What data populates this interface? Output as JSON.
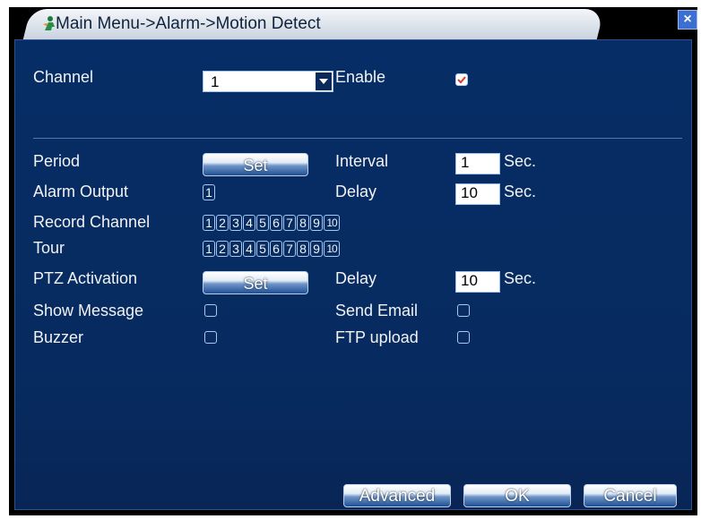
{
  "title": "Main Menu->Alarm->Motion Detect",
  "close_glyph": "×",
  "channel": {
    "label": "Channel",
    "value": "1"
  },
  "enable": {
    "label": "Enable",
    "checked": true
  },
  "period": {
    "label": "Period",
    "button": "Set"
  },
  "interval": {
    "label": "Interval",
    "value": "1",
    "unit": "Sec."
  },
  "alarm_output": {
    "label": "Alarm Output",
    "items": [
      "1"
    ]
  },
  "delay1": {
    "label": "Delay",
    "value": "10",
    "unit": "Sec."
  },
  "record_channel": {
    "label": "Record Channel",
    "items": [
      "1",
      "2",
      "3",
      "4",
      "5",
      "6",
      "7",
      "8",
      "9",
      "10"
    ]
  },
  "tour": {
    "label": "Tour",
    "items": [
      "1",
      "2",
      "3",
      "4",
      "5",
      "6",
      "7",
      "8",
      "9",
      "10"
    ]
  },
  "ptz": {
    "label": "PTZ Activation",
    "button": "Set"
  },
  "delay2": {
    "label": "Delay",
    "value": "10",
    "unit": "Sec."
  },
  "show_message": {
    "label": "Show Message",
    "checked": false
  },
  "send_email": {
    "label": "Send Email",
    "checked": false
  },
  "buzzer": {
    "label": "Buzzer",
    "checked": false
  },
  "ftp_upload": {
    "label": "FTP upload",
    "checked": false
  },
  "buttons": {
    "advanced": "Advanced",
    "ok": "OK",
    "cancel": "Cancel"
  },
  "colors": {
    "panel": "#072d66",
    "check": "#e0392b"
  }
}
